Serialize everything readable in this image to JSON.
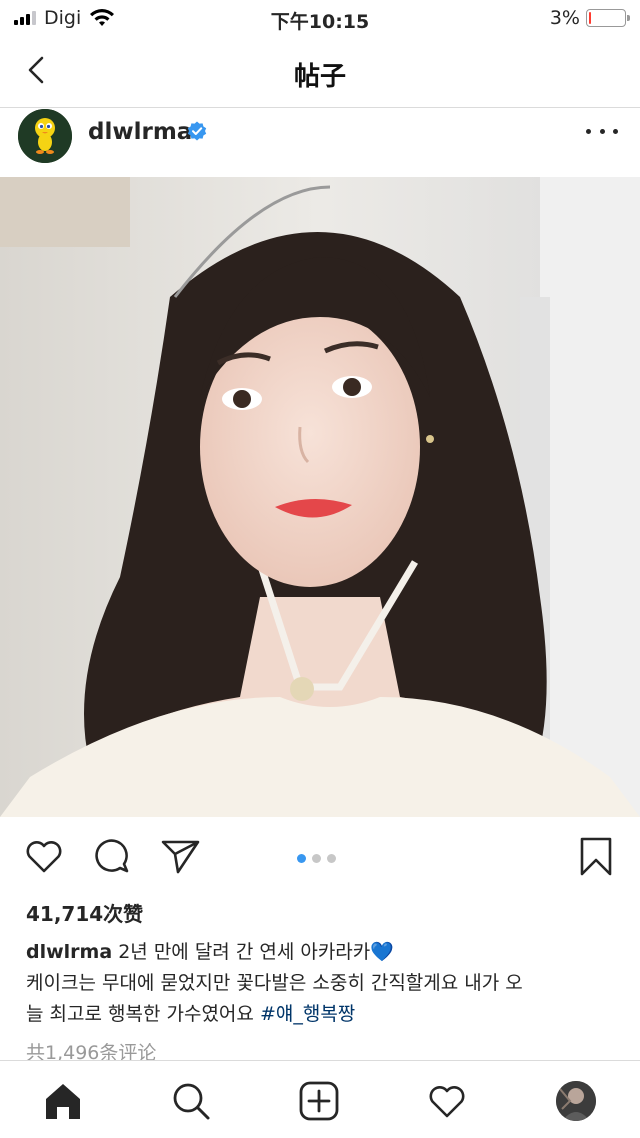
{
  "status_bar": {
    "carrier": "Digi",
    "time": "下午10:15",
    "battery_percent": "3%",
    "battery_level": 0.03
  },
  "nav": {
    "title": "帖子"
  },
  "post": {
    "username": "dlwlrma",
    "verified": true,
    "likes": "41,714次赞",
    "carousel_count": 3,
    "carousel_active": 0,
    "caption": {
      "username": "dlwlrma",
      "line1": "2년 만에 달려 간 연세 아카라카💙",
      "line2": "케이크는 무대에 묻었지만 꽃다발은 소중히 간직할게요 내가 오",
      "line3_text": "늘 최고로 행복한 가수였어요",
      "hashtag": "#얘_행복짱"
    },
    "comments": "共1,496条评论"
  },
  "icons": {
    "back": "chevron-left-icon",
    "more": "more-horizontal-icon",
    "like": "heart-icon",
    "comment": "comment-icon",
    "share": "paper-plane-icon",
    "save": "bookmark-icon",
    "home": "home-icon",
    "search": "search-icon",
    "add": "add-post-icon",
    "activity": "heart-icon",
    "profile": "profile-avatar"
  },
  "colors": {
    "verified_blue": "#3897f0",
    "hashtag": "#003569",
    "battery_low": "#ff3b30"
  }
}
